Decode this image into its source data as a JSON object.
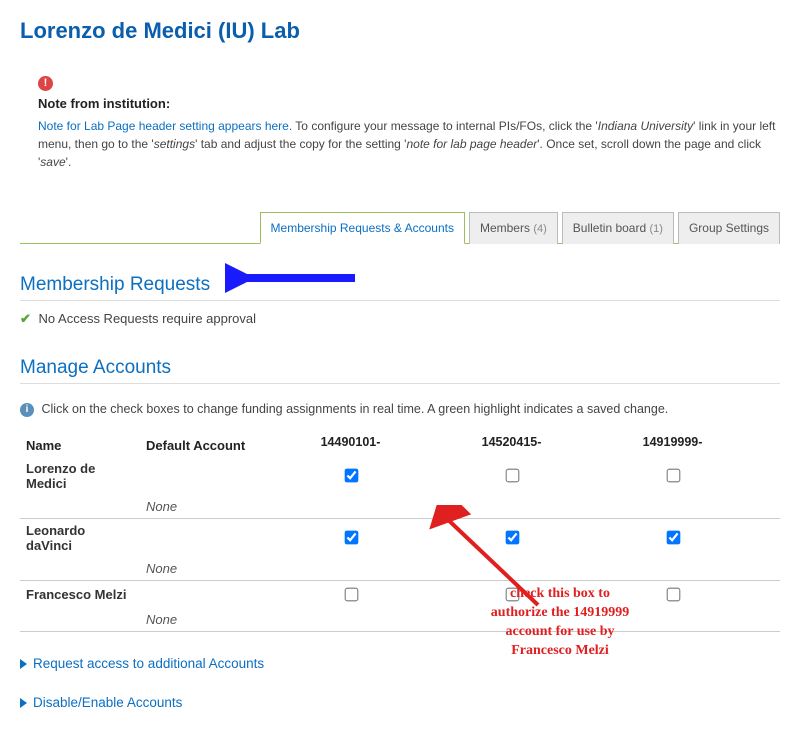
{
  "page": {
    "title": "Lorenzo de Medici (IU) Lab"
  },
  "note": {
    "label": "Note from institution:",
    "link_text": "Note for Lab Page header setting appears here.",
    "body_1": " To configure your message to internal PIs/FOs, click the '",
    "body_ital1": "Indiana University",
    "body_2": "' link in your left menu, then go to the '",
    "body_ital2": "settings",
    "body_3": "' tab and adjust the copy for the setting '",
    "body_ital3": "note for lab page header",
    "body_4": "'. Once set, scroll down the page and click '",
    "body_ital4": "save",
    "body_5": "'."
  },
  "tabs": [
    {
      "label": "Membership Requests & Accounts",
      "count": "",
      "active": true
    },
    {
      "label": "Members",
      "count": "(4)",
      "active": false
    },
    {
      "label": "Bulletin board",
      "count": "(1)",
      "active": false
    },
    {
      "label": "Group Settings",
      "count": "",
      "active": false
    }
  ],
  "sections": {
    "membership": {
      "heading": "Membership Requests",
      "status": "No Access Requests require approval"
    },
    "manage": {
      "heading": "Manage Accounts",
      "info": "Click on the check boxes to change funding assignments in real time. A green highlight indicates a saved change."
    }
  },
  "table": {
    "cols": {
      "name": "Name",
      "default": "Default Account"
    },
    "accounts": [
      "14490101-",
      "14520415-",
      "14919999-"
    ],
    "rows": [
      {
        "name": "Lorenzo de Medici",
        "default": "None",
        "checks": [
          true,
          false,
          false
        ]
      },
      {
        "name": "Leonardo daVinci",
        "default": "None",
        "checks": [
          true,
          true,
          true
        ]
      },
      {
        "name": "Francesco Melzi",
        "default": "None",
        "checks": [
          false,
          false,
          false
        ]
      }
    ]
  },
  "expanders": {
    "request": "Request access to additional Accounts",
    "disable": "Disable/Enable Accounts"
  },
  "callout": "check this box to authorize the 14919999 account for use by Francesco Melzi"
}
